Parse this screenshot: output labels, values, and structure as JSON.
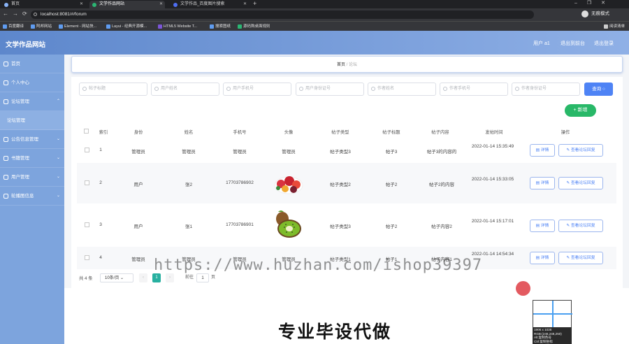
{
  "browser": {
    "tabs": [
      "首页",
      "文学作品网站",
      "文学作品_百度图片搜索"
    ],
    "url": "localhost:8081/#/forum",
    "guest_mode": "无痕模式",
    "reading_list": "阅读清单",
    "bookmarks": [
      "百度翻译",
      "阿邦网站",
      "Element - 网站快...",
      "Layui - 经典开源模...",
      "HTML5 Website T...",
      "搜索图纸",
      "源码购桌面规则"
    ]
  },
  "app": {
    "title": "文学作品网站",
    "user": "用户 a1",
    "exit_to_home": "退出到前台",
    "logout": "退出登录"
  },
  "sidebar": {
    "items": [
      "首页",
      "个人中心",
      "论坛管理",
      "论坛管理",
      "公告信息管理",
      "书籍管理",
      "用户管理",
      "轮播图信息"
    ]
  },
  "breadcrumb": {
    "home": "首页",
    "sep": "/",
    "current": "论坛"
  },
  "search": {
    "placeholders": [
      "帖子标题",
      "用户姓名",
      "用户手机号",
      "用户身份证号",
      "作者姓名",
      "作者手机号",
      "作者身份证号"
    ],
    "query_label": "查询",
    "add_label": "+ 新增"
  },
  "table": {
    "headers": [
      "索引",
      "身份",
      "姓名",
      "手机号",
      "头像",
      "帖子类型",
      "帖子标题",
      "帖子内容",
      "发帖时间",
      "操作"
    ],
    "rows": [
      {
        "index": "1",
        "role": "管理员",
        "name": "管理员",
        "phone": "管理员",
        "avatar": "管理员",
        "type": "帖子类型3",
        "title": "帖子3",
        "content": "帖子3的内容的",
        "time": "2022-01-14 15:35:49"
      },
      {
        "index": "2",
        "role": "用户",
        "name": "张2",
        "phone": "17703786902",
        "avatar": "",
        "type": "帖子类型2",
        "title": "帖子2",
        "content": "帖子2的内容",
        "time": "2022-01-14 15:33:05"
      },
      {
        "index": "3",
        "role": "用户",
        "name": "张1",
        "phone": "17703786901",
        "avatar": "",
        "type": "帖子类型3",
        "title": "帖子2",
        "content": "帖子内容2",
        "time": "2022-01-14 15:17:01"
      },
      {
        "index": "4",
        "role": "管理员",
        "name": "管理员",
        "phone": "管理员",
        "avatar": "管理员",
        "type": "帖子类型1",
        "title": "帖子1",
        "content": "帖子内容1",
        "time": "2022-01-14 14:54:34"
      }
    ],
    "detail_label": "详情",
    "reply_label": "查看论坛回复"
  },
  "pager": {
    "total": "共 4 条",
    "size": "10条/页",
    "page": "1",
    "goto": "前往",
    "goto_val": "1",
    "page_unit": "页"
  },
  "overlay": {
    "watermark": "https://www.huzhan.com/ishop39397",
    "promo": "专业毕设代做",
    "picker_info": [
      "1906 x 1038",
      "RGB:(246,248,250)",
      "Alt:复制色号",
      "Ctrl:复制坐标"
    ]
  },
  "colors": {
    "header": "#6f9ad8",
    "sidebar": "#7da4dd",
    "primary": "#4e83f5",
    "success": "#28b868"
  }
}
